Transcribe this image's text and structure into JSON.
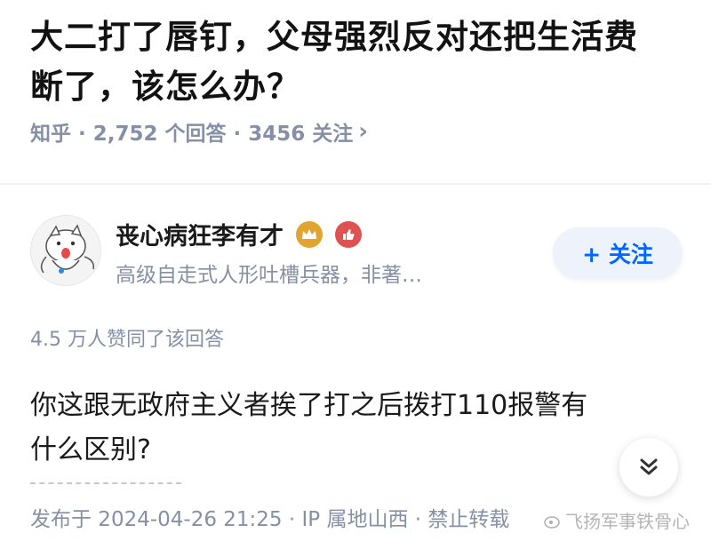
{
  "question": {
    "title_line1": "大二打了唇钉，父母强烈反对还把生活费",
    "title_line2": "断了，该怎么办？",
    "meta": "知乎 · 2,752 个回答 · 3456 关注",
    "meta_arrow": "›"
  },
  "author": {
    "name": "丧心病狂李有才",
    "bio": "高级自走式人形吐槽兵器，非著…",
    "follow_label": "+ 关注",
    "badge_colors": [
      "#e0a431",
      "#e05252"
    ]
  },
  "answer": {
    "likes": "4.5 万人赞同了该回答",
    "text_line1": "你这跟无政府主义者挨了打之后拨打110报警有",
    "text_line2": "什么区别?",
    "meta": "发布于 2024-04-26 21:25 · IP 属地山西 · 禁止转载",
    "expand_icon": "chevron-double-down-icon"
  },
  "watermark": {
    "text": "飞扬军事铁骨心",
    "icon": "weibo-icon"
  }
}
